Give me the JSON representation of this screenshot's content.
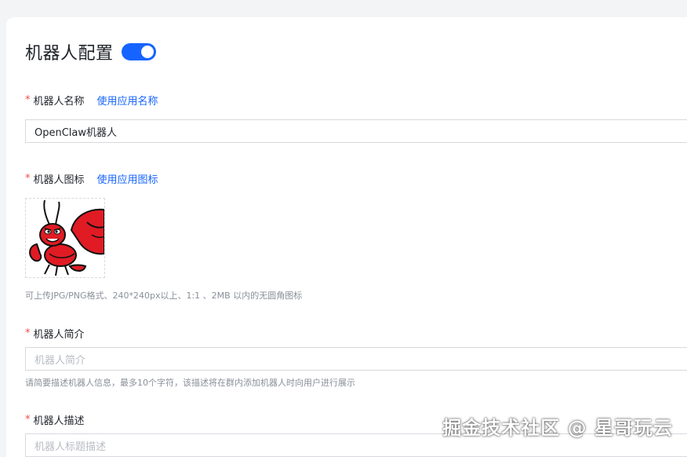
{
  "header": {
    "title": "机器人配置",
    "toggle_on": true
  },
  "name_field": {
    "label": "机器人名称",
    "link": "使用应用名称",
    "value": "OpenClaw机器人"
  },
  "icon_field": {
    "label": "机器人图标",
    "link": "使用应用图标",
    "hint": "可上传JPG/PNG格式、240*240px以上、1:1 、2MB 以内的无圆角图标"
  },
  "intro_field": {
    "label": "机器人简介",
    "placeholder": "机器人简介",
    "hint": "请简要描述机器人信息，最多10个字符，该描述将在群内添加机器人时向用户进行展示"
  },
  "desc_field": {
    "label": "机器人描述",
    "placeholder": "机器人标题描述"
  },
  "watermark": "掘金技术社区 @ 星哥玩云",
  "colors": {
    "accent": "#1664ff",
    "required": "#f54a45",
    "lobster": "#e01b24"
  }
}
